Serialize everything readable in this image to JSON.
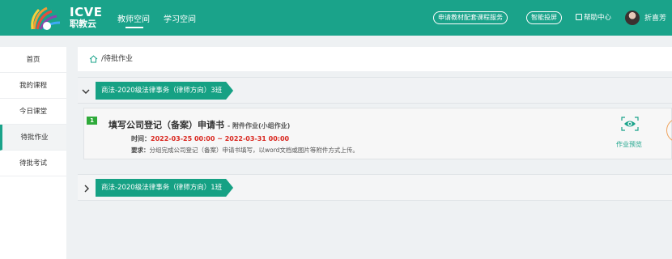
{
  "header": {
    "logo_en": "ICVE",
    "logo_cn": "职教云",
    "nav": {
      "teacher": "教师空间",
      "study": "学习空间"
    },
    "pills": {
      "materials": "申请教材配套课程服务",
      "screen": "智能投屏"
    },
    "help": "帮助中心",
    "username": "折喜芳"
  },
  "sidebar": {
    "items": [
      "首页",
      "我的课程",
      "今日课堂",
      "待批作业",
      "待批考试"
    ],
    "active_index": 3
  },
  "breadcrumb": {
    "current": "/待批作业"
  },
  "groups": [
    {
      "class_name": "商法-2020级法律事务（律师方向）3班",
      "expanded": true
    },
    {
      "class_name": "商法-2020级法律事务（律师方向）1班",
      "expanded": false
    }
  ],
  "task": {
    "number": "1",
    "title": "填写公司登记（备案）申请书",
    "type": "- 附件作业(小组作业)",
    "time_label": "时间：",
    "time_value": "2022-03-25 00:00 ~ 2022-03-31 00:00",
    "req_label": "要求：",
    "req_value": "分组完成公司登记（备案）申请书填写，以word文档或图片等附件方式上传。",
    "preview_label": "作业预览"
  },
  "colors": {
    "brand": "#1aa38a",
    "tag": "#16a184",
    "badge": "#2eaa3a",
    "time": "#d9251d",
    "accent_orange": "#f0a35e"
  }
}
